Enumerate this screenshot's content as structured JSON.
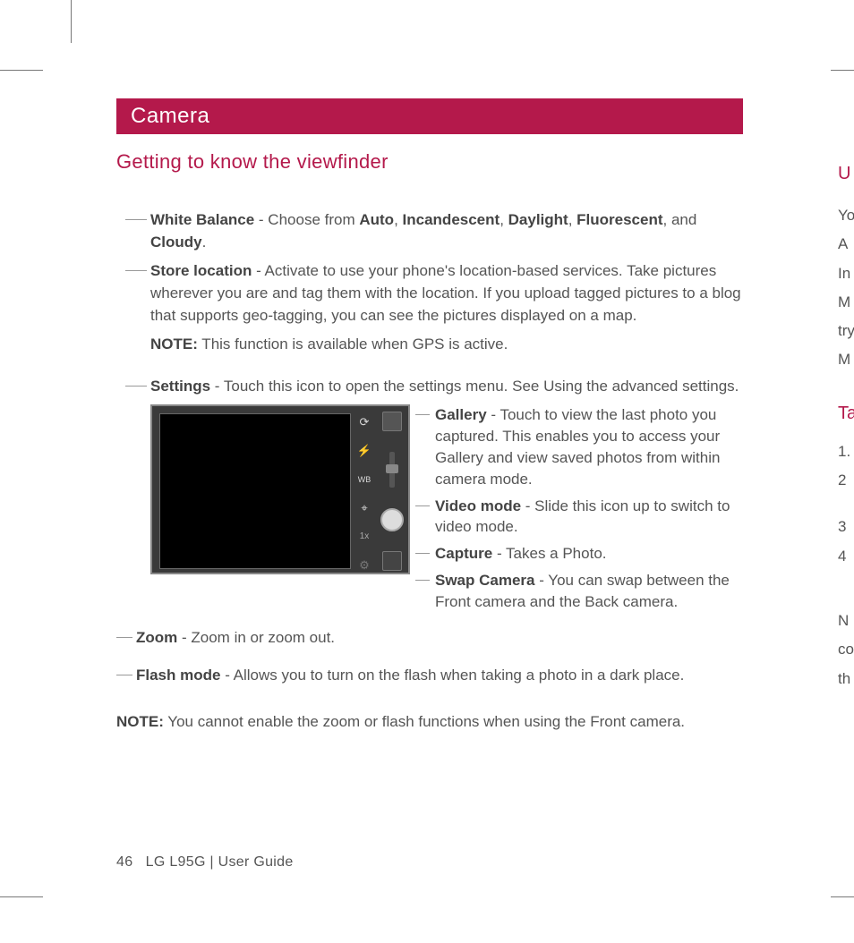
{
  "section_title": "Camera",
  "subheading": "Getting to know the viewfinder",
  "items": {
    "white_balance": {
      "label": "White Balance",
      "text": " - Choose from ",
      "opts": [
        "Auto",
        "Incandescent",
        "Daylight",
        "Fluorescent",
        "Cloudy"
      ],
      "after": "."
    },
    "store_location": {
      "label": "Store location",
      "text": " - Activate to use your phone's location-based services. Take pictures wherever you are and tag them with the location. If you upload tagged pictures to a blog that supports geo-tagging, you can see the pictures displayed on a map."
    },
    "store_location_note": {
      "label": "NOTE:",
      "text": " This function is available when GPS is active."
    },
    "settings": {
      "label": "Settings",
      "text": " - Touch this icon to open the settings menu. See Using the advanced settings."
    },
    "gallery": {
      "label": "Gallery",
      "text": " - Touch to view the last photo you captured. This enables you to access your Gallery and view saved photos from within camera mode."
    },
    "video_mode": {
      "label": "Video mode",
      "text": " - Slide this icon up to switch to video mode."
    },
    "capture": {
      "label": "Capture",
      "text": " - Takes a Photo."
    },
    "swap_camera": {
      "label": "Swap Camera",
      "text": " - You can swap between the Front camera and the Back camera."
    },
    "zoom": {
      "label": "Zoom",
      "text": " - Zoom in or zoom out."
    },
    "flash_mode": {
      "label": "Flash mode",
      "text": " - Allows you to turn on the flash when taking a photo in a dark place."
    }
  },
  "footer_note": {
    "label": "NOTE:",
    "text": " You cannot enable the zoom or flash functions when using the Front camera."
  },
  "viewfinder_icons": {
    "swap": "⟳",
    "flash": "⚡",
    "wb": "WB",
    "geo": "⌖",
    "zoom": "1x",
    "settings": "⚙"
  },
  "page_footer": {
    "page_number": "46",
    "product": "LG L95G",
    "separator": "  |  ",
    "doc": "User Guide"
  },
  "cutoff": {
    "l1": "U",
    "l2": "Yo",
    "l3": "A",
    "l4": "In",
    "l5": "M",
    "l6": "try",
    "l7": "M",
    "l8": "Ta",
    "l9": "1.",
    "l10": "2",
    "l11": "3",
    "l12": "4",
    "l13": "N",
    "l14": "co",
    "l15": "th"
  }
}
